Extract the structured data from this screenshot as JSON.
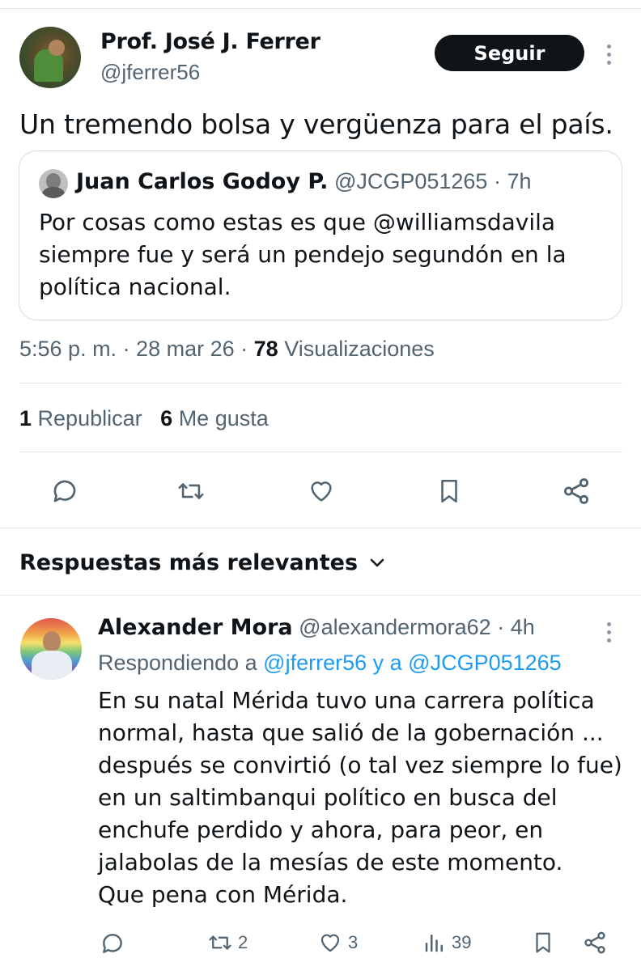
{
  "tweet": {
    "author_name": "Prof. José J. Ferrer",
    "author_handle": "@jferrer56",
    "follow_label": "Seguir",
    "text": "Un tremendo bolsa y vergüenza para el país.",
    "quote": {
      "name": "Juan Carlos Godoy P.",
      "handle_time": "@JCGP051265 · 7h",
      "lines": [
        "Por cosas como estas es que @williamsdavila",
        "siempre fue y será un pendejo segundón en la",
        "política nacional."
      ]
    },
    "timestamp": "5:56 p. m. · 28 mar 26 · ",
    "views_count": "78",
    "views_label": "Visualizaciones",
    "reposts_count": "1",
    "reposts_label": "Republicar",
    "likes_count": "6",
    "likes_label": "Me gusta"
  },
  "icons": {
    "reply": "reply-icon",
    "repost": "repost-icon",
    "like": "heart-icon",
    "bookmark": "bookmark-icon",
    "share": "share-icon",
    "views": "views-icon",
    "more": "more-icon",
    "chevron": "chevron-down-icon"
  },
  "replies_section": {
    "title": "Respuestas más relevantes"
  },
  "reply": {
    "name": "Alexander Mora",
    "handle_time": "@alexandermora62 · 4h",
    "replying_prefix": "Respondiendo a ",
    "mention1": "@jferrer56",
    "connector": " y a ",
    "mention2": "@JCGP051265",
    "lines": [
      "En su natal Mérida tuvo una carrera política",
      "normal, hasta que salió de la gobernación ...",
      "después se convirtió (o tal vez siempre lo fue)",
      "en un saltimbanqui político en busca del",
      "enchufe perdido y ahora, para peor, en",
      "jalabolas de la mesías de este momento.",
      "Que pena con Mérida."
    ],
    "reposts": "2",
    "likes": "3",
    "views": "39"
  },
  "colors": {
    "text": "#0f1419",
    "muted": "#536471",
    "link": "#1d9bf0",
    "divider": "#e6e9ec",
    "button": "#0f1419"
  }
}
